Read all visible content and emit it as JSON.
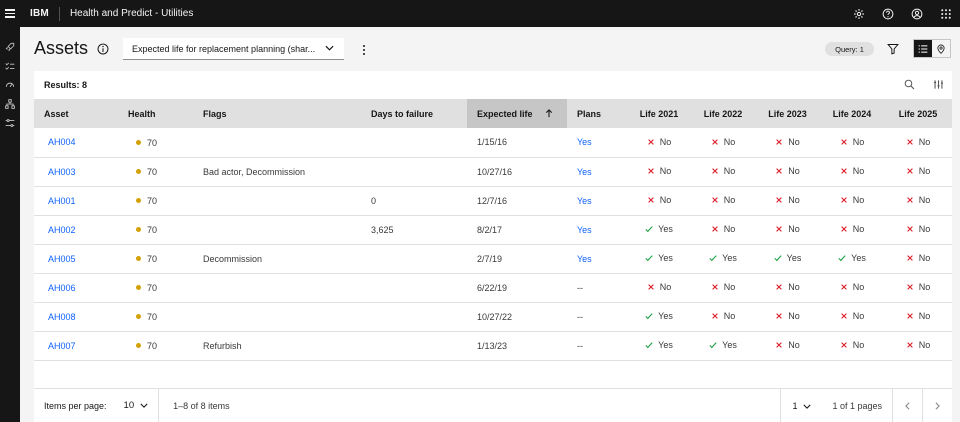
{
  "header": {
    "brand": "IBM",
    "app_title": "Health and Predict - Utilities",
    "actions": [
      "settings-icon",
      "help-icon",
      "user-icon",
      "app-switcher-icon"
    ]
  },
  "rail": {
    "icons": [
      "rocket-icon",
      "checklist-icon",
      "gauge-icon",
      "hierarchy-icon",
      "sliders-icon"
    ]
  },
  "page": {
    "title": "Assets",
    "view_select": "Expected life for replacement planning (shar...",
    "query_tag": "Query: 1"
  },
  "table": {
    "results_label": "Results: 8",
    "columns": [
      "Asset",
      "Health",
      "Flags",
      "Days to failure",
      "Expected life",
      "Plans",
      "Life 2021",
      "Life 2022",
      "Life 2023",
      "Life 2024",
      "Life 2025"
    ],
    "sorted_column": "Expected life",
    "bool_labels": {
      "yes": "Yes",
      "no": "No"
    },
    "rows": [
      {
        "asset": "AH004",
        "health": "70",
        "flags": "",
        "days": "",
        "expected": "1/15/16",
        "plans": "Yes",
        "life": [
          "No",
          "No",
          "No",
          "No",
          "No"
        ]
      },
      {
        "asset": "AH003",
        "health": "70",
        "flags": "Bad actor, Decommission",
        "days": "",
        "expected": "10/27/16",
        "plans": "Yes",
        "life": [
          "No",
          "No",
          "No",
          "No",
          "No"
        ]
      },
      {
        "asset": "AH001",
        "health": "70",
        "flags": "",
        "days": "0",
        "expected": "12/7/16",
        "plans": "Yes",
        "life": [
          "No",
          "No",
          "No",
          "No",
          "No"
        ]
      },
      {
        "asset": "AH002",
        "health": "70",
        "flags": "",
        "days": "3,625",
        "expected": "8/2/17",
        "plans": "Yes",
        "life": [
          "Yes",
          "No",
          "No",
          "No",
          "No"
        ]
      },
      {
        "asset": "AH005",
        "health": "70",
        "flags": "Decommission",
        "days": "",
        "expected": "2/7/19",
        "plans": "Yes",
        "life": [
          "Yes",
          "Yes",
          "Yes",
          "Yes",
          "No"
        ]
      },
      {
        "asset": "AH006",
        "health": "70",
        "flags": "",
        "days": "",
        "expected": "6/22/19",
        "plans": "--",
        "life": [
          "No",
          "No",
          "No",
          "No",
          "No"
        ]
      },
      {
        "asset": "AH008",
        "health": "70",
        "flags": "",
        "days": "",
        "expected": "10/27/22",
        "plans": "--",
        "life": [
          "Yes",
          "No",
          "No",
          "No",
          "No"
        ]
      },
      {
        "asset": "AH007",
        "health": "70",
        "flags": "Refurbish",
        "days": "",
        "expected": "1/13/23",
        "plans": "--",
        "life": [
          "Yes",
          "Yes",
          "No",
          "No",
          "No"
        ]
      }
    ]
  },
  "pagination": {
    "items_per_page_label": "Items per page:",
    "items_per_page": "10",
    "range": "1–8 of 8 items",
    "page": "1",
    "of_pages": "1 of 1 pages"
  },
  "colors": {
    "link": "#0f62fe",
    "health_dot": "#d2a106",
    "yes": "#24a148",
    "no": "#da1e28",
    "header_bg": "#161616"
  }
}
